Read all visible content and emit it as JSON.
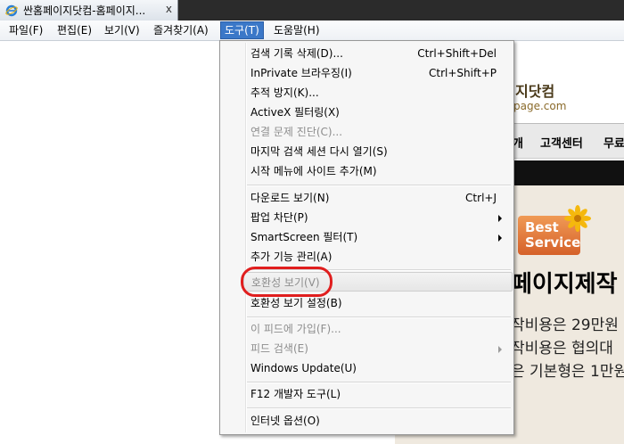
{
  "tab": {
    "title": "싼홈페이지닷컴-홈페이지...",
    "close_glyph": "x"
  },
  "menubar": {
    "items": [
      "파일(F)",
      "편집(E)",
      "보기(V)",
      "즐겨찾기(A)",
      "도구(T)",
      "도움말(H)"
    ],
    "active_index": 4
  },
  "page": {
    "logo_main": "지닷컴",
    "logo_sub": "page.com",
    "nav": [
      "개",
      "고객센터",
      "무료"
    ],
    "best_line1": "Best",
    "best_line2": "Service",
    "headline": "페이지제작",
    "line1": "작비용은 29만원",
    "line2": "작비용은 협의대",
    "line3": "은 기본형은 1만원"
  },
  "tools_menu": {
    "items": [
      {
        "label": "검색 기록 삭제(D)...",
        "shortcut": "Ctrl+Shift+Del"
      },
      {
        "label": "InPrivate 브라우징(I)",
        "shortcut": "Ctrl+Shift+P"
      },
      {
        "label": "추적 방지(K)...",
        "shortcut": ""
      },
      {
        "label": "ActiveX 필터링(X)",
        "shortcut": ""
      },
      {
        "label": "연결 문제 진단(C)...",
        "shortcut": "",
        "disabled": true
      },
      {
        "label": "마지막 검색 세션 다시 열기(S)",
        "shortcut": ""
      },
      {
        "label": "시작 메뉴에 사이트 추가(M)",
        "shortcut": ""
      },
      {
        "label": "다운로드 보기(N)",
        "shortcut": "Ctrl+J"
      },
      {
        "label": "팝업 차단(P)",
        "shortcut": "",
        "submenu": true
      },
      {
        "label": "SmartScreen 필터(T)",
        "shortcut": "",
        "submenu": true
      },
      {
        "label": "추가 기능 관리(A)",
        "shortcut": ""
      },
      {
        "label": "호환성 보기(V)",
        "shortcut": "",
        "disabled": true,
        "highlighted": true
      },
      {
        "label": "호환성 보기 설정(B)",
        "shortcut": ""
      },
      {
        "label": "이 피드에 가입(F)...",
        "shortcut": "",
        "disabled": true
      },
      {
        "label": "피드 검색(E)",
        "shortcut": "",
        "disabled": true,
        "submenu": true
      },
      {
        "label": "Windows Update(U)",
        "shortcut": ""
      },
      {
        "label": "F12 개발자 도구(L)",
        "shortcut": ""
      },
      {
        "label": "인터넷 옵션(O)",
        "shortcut": ""
      }
    ]
  },
  "colors": {
    "menu_active": "#3b78c8",
    "annotation_circle": "#e01e1e",
    "disabled_text": "#8d8d8d"
  }
}
